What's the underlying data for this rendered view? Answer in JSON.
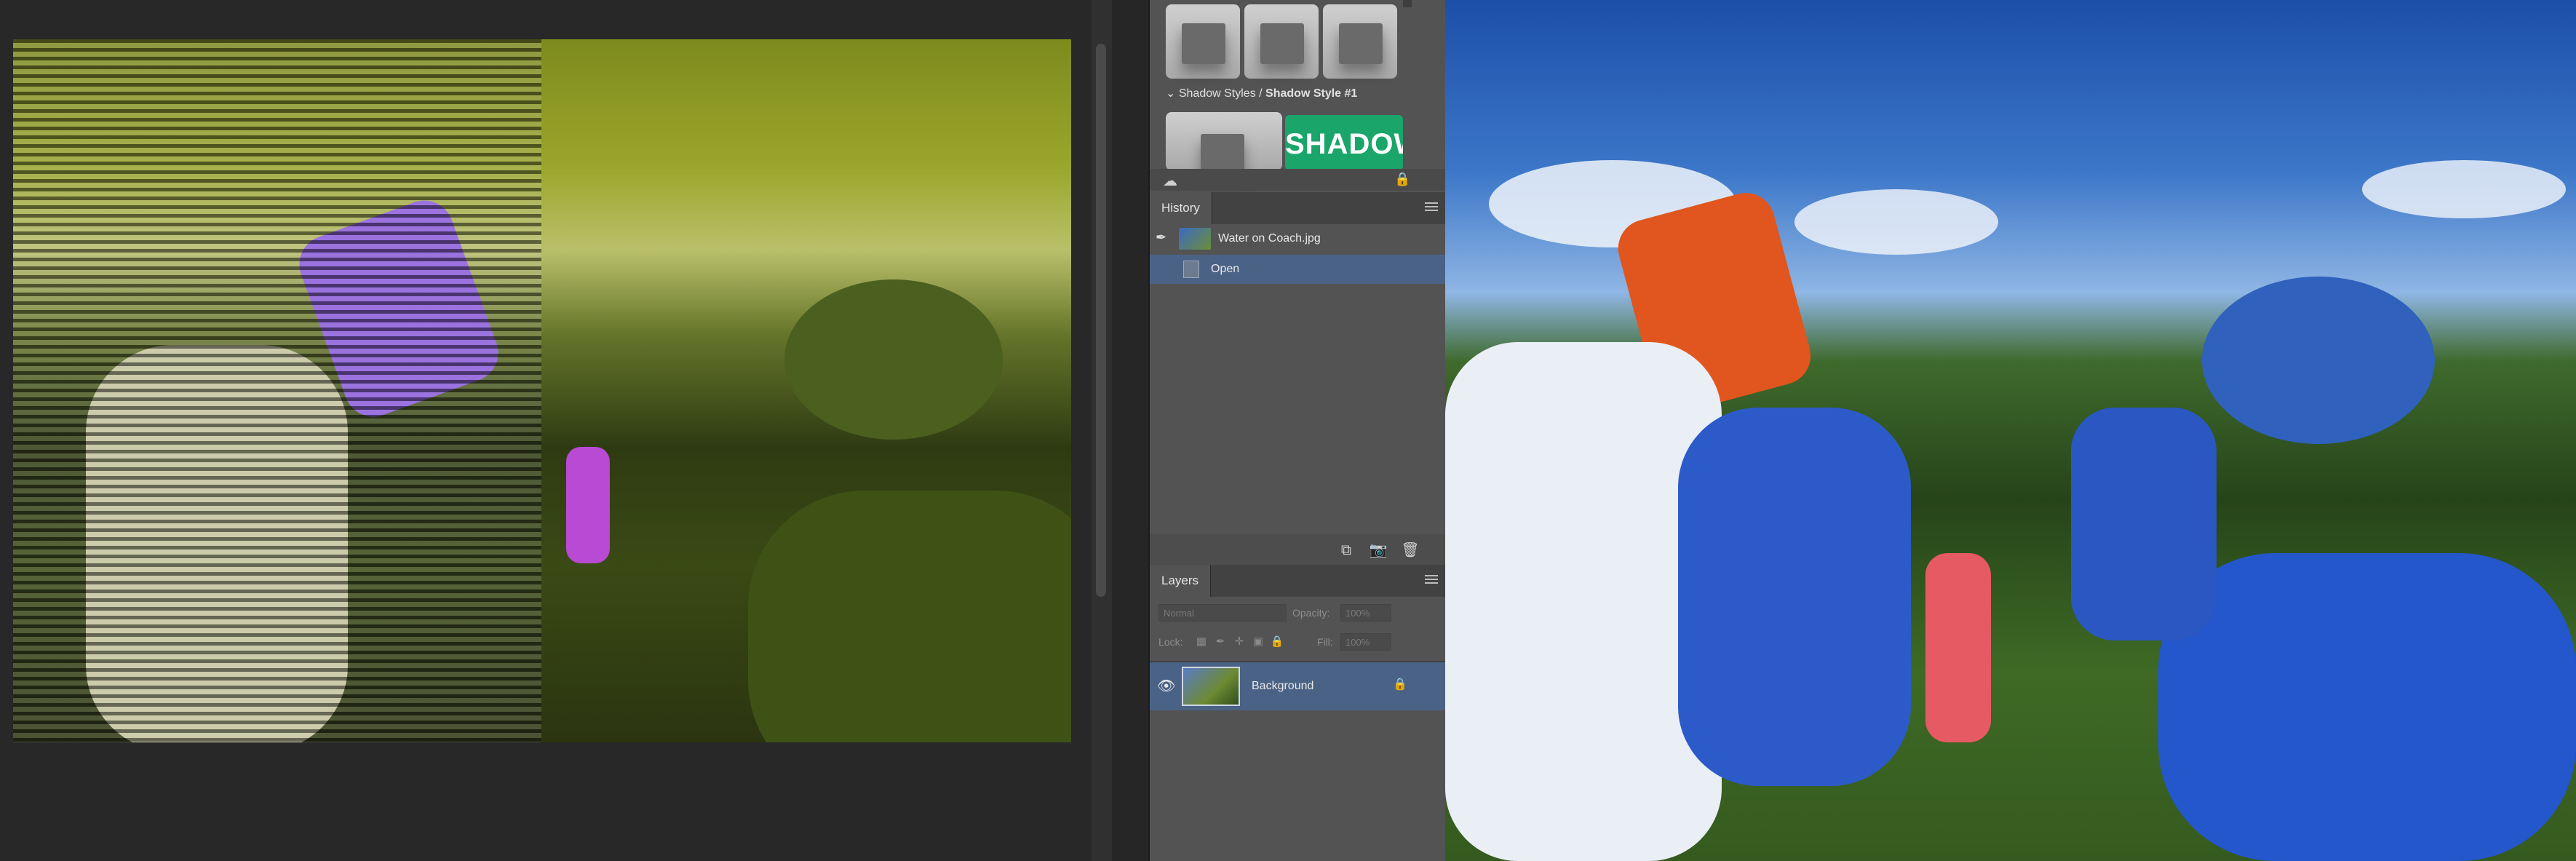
{
  "styles_panel": {
    "breadcrumb_group": "Shadow Styles",
    "breadcrumb_separator": " / ",
    "breadcrumb_item": "Shadow Style #1",
    "shadow_preview_text": "SHADOW"
  },
  "history_panel": {
    "tab_label": "History",
    "snapshot_label": "Water on Coach.jpg",
    "steps": [
      {
        "label": "Open",
        "selected": true
      }
    ]
  },
  "layers_panel": {
    "tab_label": "Layers",
    "blend_mode": "Normal",
    "opacity_label": "Opacity:",
    "opacity_value": "100%",
    "lock_label": "Lock:",
    "fill_label": "Fill:",
    "fill_value": "100%",
    "layers": [
      {
        "name": "Background",
        "visible": true,
        "locked": true,
        "selected": true
      }
    ]
  },
  "colors": {
    "panel_bg": "#535353",
    "panel_header": "#424242",
    "selection": "#4a6286",
    "shadow_swatch": "#1aa56b"
  },
  "icons": [
    "cloud-icon",
    "lock-icon",
    "brush-icon",
    "document-icon",
    "new-snapshot-icon",
    "camera-icon",
    "trash-icon",
    "eye-icon",
    "panel-menu-icon"
  ]
}
